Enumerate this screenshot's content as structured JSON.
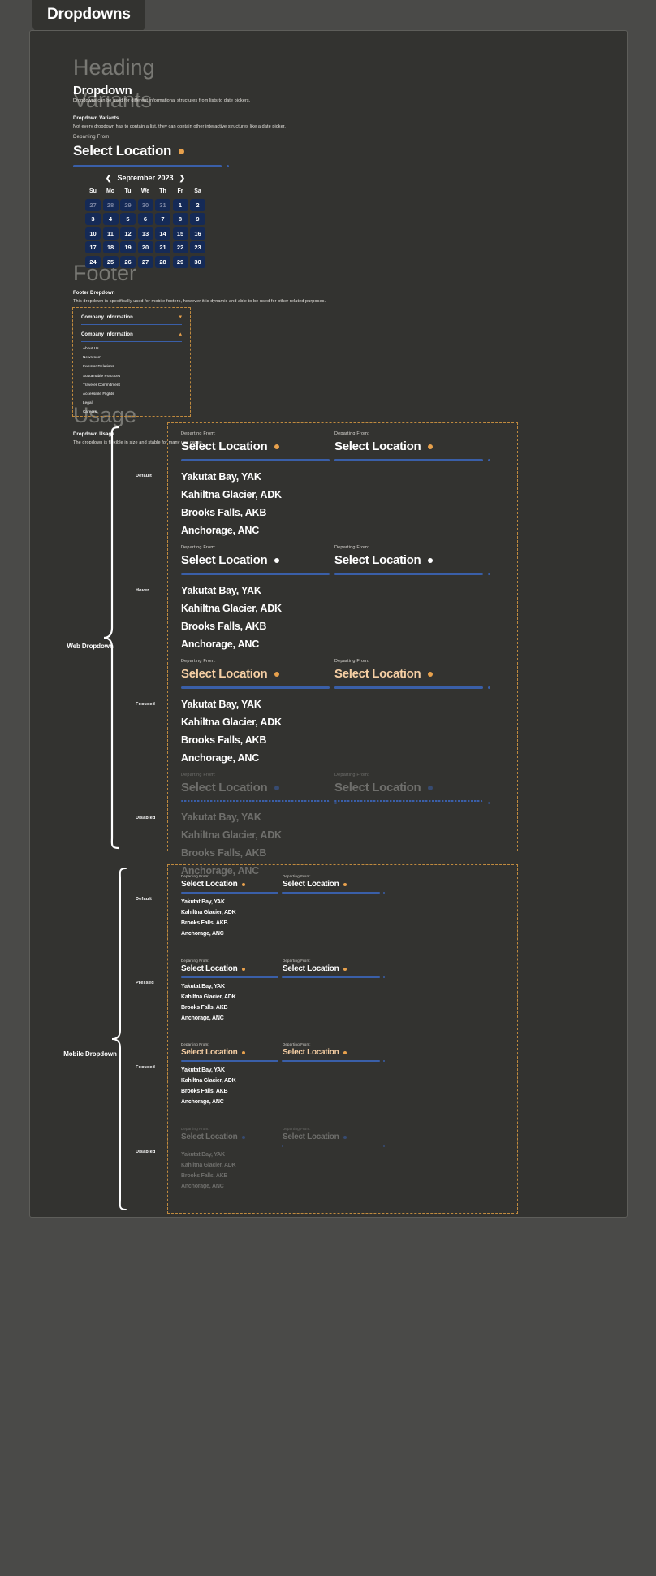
{
  "tab": {
    "label": "Dropdowns"
  },
  "ghosts": {
    "heading": "Heading",
    "variants": "Variants",
    "footer": "Footer",
    "usage": "Usage"
  },
  "intro": {
    "title": "Dropdown",
    "subtitle": "Dropdowns can be used for different informational structures from lists to date pickers."
  },
  "variants": {
    "title": "Dropdown Variants",
    "subtitle": "Not every dropdown has to contain a list, they can contain other interactive structures like a date picker."
  },
  "dropdown": {
    "label": "Departing From:",
    "value": "Select Location",
    "options": [
      "Yakutat Bay, YAK",
      "Kahiltna Glacier, ADK",
      "Brooks Falls, AKB",
      "Anchorage, ANC"
    ]
  },
  "calendar": {
    "month": "September 2023",
    "prev_icon": "chevron-left",
    "next_icon": "chevron-right",
    "dow": [
      "Su",
      "Mo",
      "Tu",
      "We",
      "Th",
      "Fr",
      "Sa"
    ],
    "weeks": [
      [
        {
          "n": "27",
          "muted": true
        },
        {
          "n": "28",
          "muted": true
        },
        {
          "n": "29",
          "muted": true
        },
        {
          "n": "30",
          "muted": true
        },
        {
          "n": "31",
          "muted": true
        },
        {
          "n": "1",
          "muted": false
        },
        {
          "n": "2",
          "muted": false
        }
      ],
      [
        {
          "n": "3",
          "muted": false
        },
        {
          "n": "4",
          "muted": false
        },
        {
          "n": "5",
          "muted": false
        },
        {
          "n": "6",
          "muted": false
        },
        {
          "n": "7",
          "muted": false
        },
        {
          "n": "8",
          "muted": false
        },
        {
          "n": "9",
          "muted": false
        }
      ],
      [
        {
          "n": "10",
          "muted": false
        },
        {
          "n": "11",
          "muted": false
        },
        {
          "n": "12",
          "muted": false
        },
        {
          "n": "13",
          "muted": false
        },
        {
          "n": "14",
          "muted": false
        },
        {
          "n": "15",
          "muted": false
        },
        {
          "n": "16",
          "muted": false
        }
      ],
      [
        {
          "n": "17",
          "muted": false
        },
        {
          "n": "18",
          "muted": false
        },
        {
          "n": "19",
          "muted": false
        },
        {
          "n": "20",
          "muted": false
        },
        {
          "n": "21",
          "muted": false
        },
        {
          "n": "22",
          "muted": false
        },
        {
          "n": "23",
          "muted": false
        }
      ],
      [
        {
          "n": "24",
          "muted": false
        },
        {
          "n": "25",
          "muted": false
        },
        {
          "n": "26",
          "muted": false
        },
        {
          "n": "27",
          "muted": false
        },
        {
          "n": "28",
          "muted": false
        },
        {
          "n": "29",
          "muted": false
        },
        {
          "n": "30",
          "muted": false
        }
      ]
    ]
  },
  "footer_section": {
    "title": "Footer Dropdown",
    "subtitle": "This dropdown is specifically used for mobile footers, however it is dynamic and able to be used for other related purposes.",
    "collapsed": {
      "label": "Company Information",
      "chevron": "chevron-down"
    },
    "expanded": {
      "label": "Company Information",
      "chevron": "chevron-up"
    },
    "links": [
      "About Us",
      "Newsroom",
      "Investor Relations",
      "Sustainable Practices",
      "Traveler Commitment",
      "Accessible Flights",
      "Legal",
      "Careers"
    ]
  },
  "usage": {
    "title": "Dropdown Usage",
    "subtitle": "The dropdown is flexible in size and stable for many use cases.",
    "web_group": "Web Dropdown",
    "mobile_group": "Mobile Dropdown",
    "web_states": [
      "Default",
      "Hover",
      "Focused",
      "Disabled"
    ],
    "mobile_states": [
      "Default",
      "Pressed",
      "Focused",
      "Disabled"
    ]
  },
  "colors": {
    "page_bg": "#4a4a48",
    "panel_bg": "#333330",
    "accent_orange": "#e8a14c",
    "accent_blue": "#3a5fa8",
    "calendar_cell": "#152a56",
    "focus_text": "#f6cfa4",
    "disabled_text": "#6f6f6c",
    "dashed_border": "#c08a3e"
  }
}
